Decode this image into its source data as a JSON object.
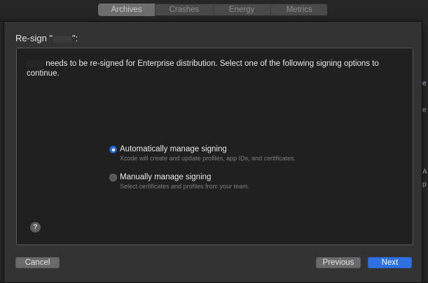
{
  "toolbar": {
    "tabs": [
      {
        "label": "Archives",
        "active": true
      },
      {
        "label": "Crashes",
        "active": false
      },
      {
        "label": "Energy",
        "active": false
      },
      {
        "label": "Metrics",
        "active": false
      }
    ]
  },
  "sheet": {
    "title_prefix": "Re-sign \"",
    "title_suffix": "\":",
    "message_suffix": "needs to be re-signed for Enterprise distribution. Select one of the following signing options to continue.",
    "options": [
      {
        "label": "Automatically manage signing",
        "description": "Xcode will create and update profiles, app IDs, and certificates.",
        "selected": true
      },
      {
        "label": "Manually manage signing",
        "description": "Select certificates and profiles from your team.",
        "selected": false
      }
    ],
    "help_label": "?",
    "buttons": {
      "cancel": "Cancel",
      "previous": "Previous",
      "next": "Next"
    }
  },
  "background": {
    "right_glyphs": [
      "e",
      "e",
      "A",
      "p"
    ]
  },
  "colors": {
    "accent": "#2f6fe0",
    "sheet_bg": "#323232",
    "content_bg": "#202020"
  }
}
